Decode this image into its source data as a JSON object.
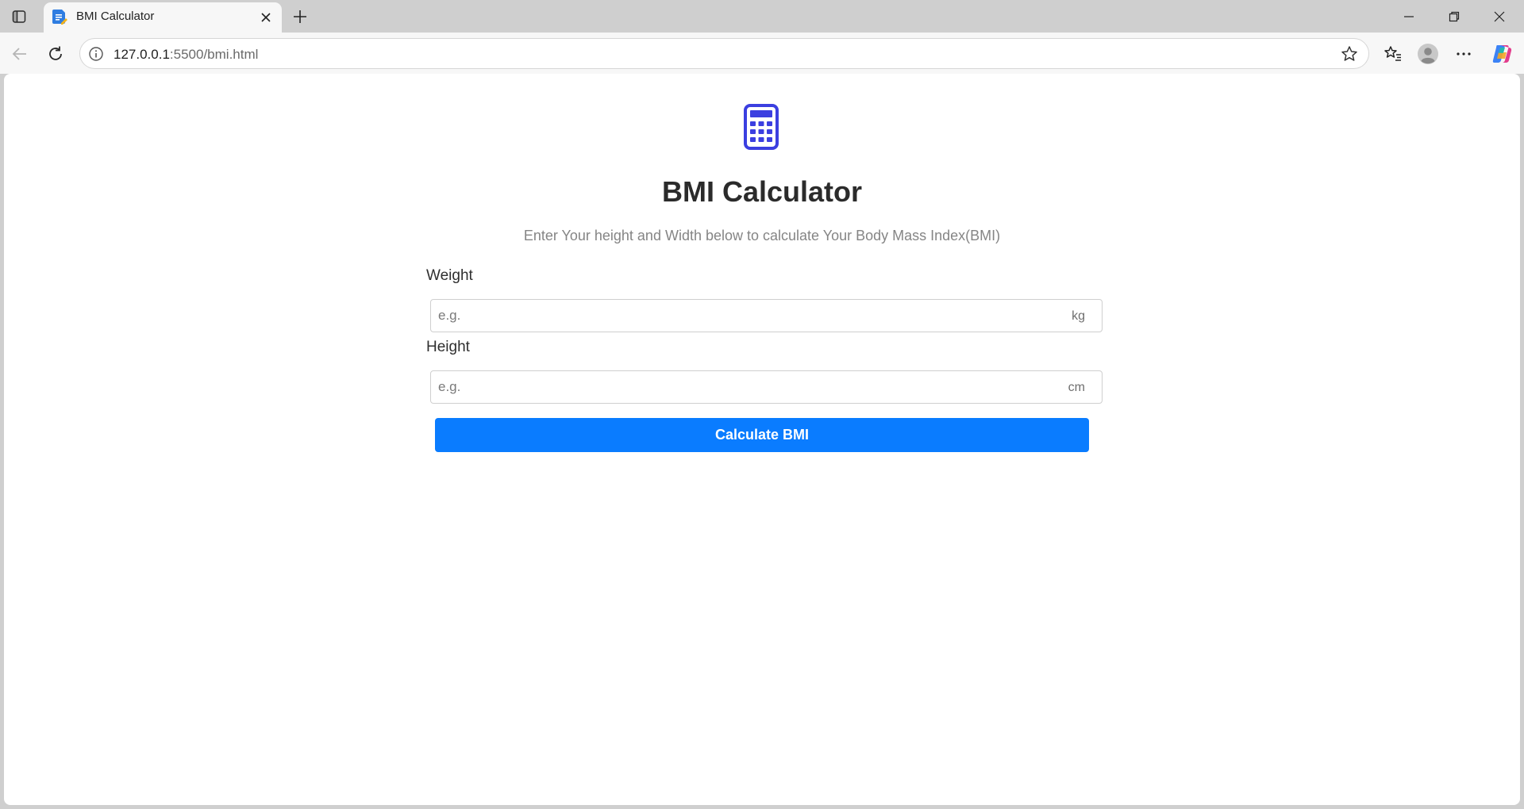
{
  "browser": {
    "tab_title": "BMI Calculator",
    "url_host": "127.0.0.1",
    "url_path": ":5500/bmi.html"
  },
  "page": {
    "icon": "calculator-icon",
    "title": "BMI Calculator",
    "subtitle": "Enter Your height and Width below to calculate Your Body Mass Index(BMI)",
    "weight": {
      "label": "Weight",
      "placeholder": "e.g.",
      "unit": "kg",
      "value": ""
    },
    "height": {
      "label": "Height",
      "placeholder": "e.g.",
      "unit": "cm",
      "value": ""
    },
    "button_label": "Calculate BMI"
  },
  "colors": {
    "accent": "#0a7cff",
    "icon": "#3b3fe0",
    "title": "#2b2b2b",
    "subtitle": "#858585"
  }
}
